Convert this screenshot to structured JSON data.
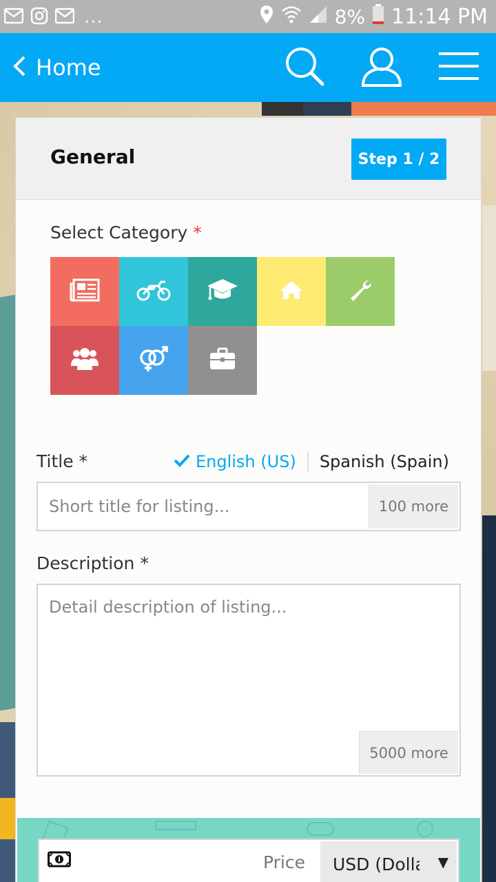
{
  "status_bar": {
    "left_overflow": "...",
    "battery_percent": "8%",
    "time": "11:14 PM",
    "icons": [
      "mail-icon",
      "instagram-icon",
      "mail-icon",
      "location-icon",
      "wifi-icon",
      "signal-icon",
      "battery-low-icon"
    ]
  },
  "app_bar": {
    "back_label": "Home",
    "color": "#03a9f4",
    "actions": [
      "search-icon",
      "user-icon",
      "menu-icon"
    ]
  },
  "form": {
    "section_title": "General",
    "step_label": "Step 1 / 2",
    "select_category_label": "Select Category",
    "required_mark": "*",
    "categories": [
      {
        "icon": "newspaper-icon",
        "color": "#f26d60"
      },
      {
        "icon": "motorcycle-icon",
        "color": "#32c5d9"
      },
      {
        "icon": "graduation-cap-icon",
        "color": "#2ea89c"
      },
      {
        "icon": "home-icon",
        "color": "#fdeb72"
      },
      {
        "icon": "wrench-icon",
        "color": "#9ccc6a"
      },
      {
        "icon": "users-icon",
        "color": "#d9535b"
      },
      {
        "icon": "gender-icon",
        "color": "#45a3ee"
      },
      {
        "icon": "briefcase-icon",
        "color": "#909090"
      }
    ],
    "title_label": "Title *",
    "languages": [
      {
        "label": "English (US)",
        "active": true
      },
      {
        "label": "Spanish (Spain)",
        "active": false
      }
    ],
    "title_placeholder": "Short title for listing...",
    "title_counter": "100 more",
    "description_label": "Description *",
    "description_placeholder": "Detail description of listing...",
    "description_counter": "5000 more",
    "price_label": "Price",
    "currency_value": "USD (Dollar)",
    "price_band_color": "#76d7c4"
  }
}
